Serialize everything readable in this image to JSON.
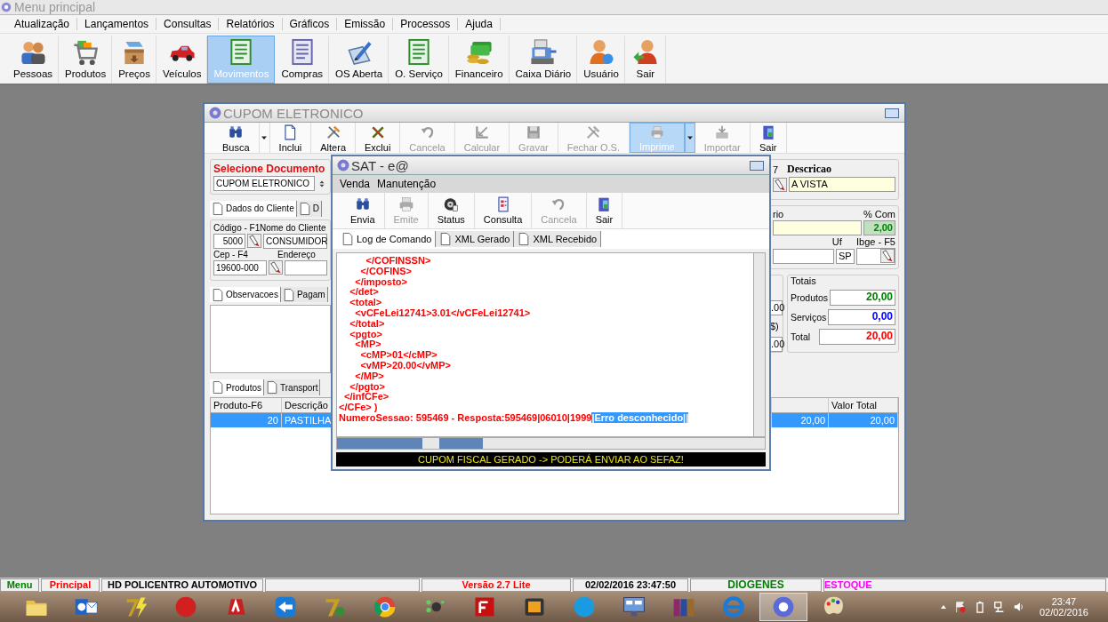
{
  "app": {
    "title": "Menu principal",
    "menu": [
      "Atualização",
      "Lançamentos",
      "Consultas",
      "Relatórios",
      "Gráficos",
      "Emissão",
      "Processos",
      "Ajuda"
    ],
    "toolbar": [
      {
        "label": "Pessoas",
        "selected": false
      },
      {
        "label": "Produtos",
        "selected": false
      },
      {
        "label": "Preços",
        "selected": false
      },
      {
        "label": "Veículos",
        "selected": false
      },
      {
        "label": "Movimentos",
        "selected": true
      },
      {
        "label": "Compras",
        "selected": false
      },
      {
        "label": "OS Aberta",
        "selected": false
      },
      {
        "label": "O. Serviço",
        "selected": false
      },
      {
        "label": "Financeiro",
        "selected": false
      },
      {
        "label": "Caixa Diário",
        "selected": false
      },
      {
        "label": "Usuário",
        "selected": false
      },
      {
        "label": "Sair",
        "selected": false
      }
    ]
  },
  "cupom": {
    "title": "CUPOM ELETRONICO",
    "toolbar": [
      {
        "label": "Busca",
        "disabled": false,
        "selected": false,
        "dropdown": true
      },
      {
        "label": "Inclui",
        "disabled": false,
        "selected": false,
        "dropdown": false
      },
      {
        "label": "Altera",
        "disabled": false,
        "selected": false,
        "dropdown": false
      },
      {
        "label": "Exclui",
        "disabled": false,
        "selected": false,
        "dropdown": false
      },
      {
        "label": "Cancela",
        "disabled": true,
        "selected": false,
        "dropdown": false
      },
      {
        "label": "Calcular",
        "disabled": true,
        "selected": false,
        "dropdown": false
      },
      {
        "label": "Gravar",
        "disabled": true,
        "selected": false,
        "dropdown": false
      },
      {
        "label": "Fechar O.S.",
        "disabled": true,
        "selected": false,
        "dropdown": false
      },
      {
        "label": "Imprime",
        "disabled": true,
        "selected": true,
        "dropdown": true
      },
      {
        "label": "Importar",
        "disabled": true,
        "selected": false,
        "dropdown": false
      },
      {
        "label": "Sair",
        "disabled": false,
        "selected": false,
        "dropdown": false
      }
    ],
    "document": {
      "label": "Selecione Documento",
      "value": "CUPOM ELETRONICO"
    },
    "client_tabs": [
      {
        "label": "Dados do Cliente",
        "selected": true
      },
      {
        "label": "D",
        "selected": false
      }
    ],
    "client": {
      "code_label": "Código - F1",
      "code": "5000",
      "name_label": "Nome do Cliente",
      "name": "CONSUMIDOR",
      "cep_label": "Cep - F4",
      "cep": "19600-000",
      "address_label": "Endereço"
    },
    "notes_tabs": [
      {
        "label": "Observacoes",
        "selected": true
      },
      {
        "label": "Pagam",
        "selected": false
      }
    ],
    "items_tabs": [
      {
        "label": "Produtos",
        "selected": true
      },
      {
        "label": "Transport",
        "selected": false
      }
    ],
    "payment": {
      "code_label": "7",
      "description_label": "Descricao",
      "description": "A VISTA"
    },
    "seller": {
      "label": "rio",
      "commission_label": "% Com",
      "commission": "2,00",
      "uf_label": "Uf",
      "uf": "SP",
      "ibge_label": "Ibge - F5"
    },
    "discounts": {
      "value_1": ".00",
      "label": "$)",
      "value_2": ".00"
    },
    "totals": {
      "title": "Totais",
      "rows": [
        {
          "label": "Produtos",
          "value": "20,00",
          "color": "#008000"
        },
        {
          "label": "Serviços",
          "value": "0,00",
          "color": "#0000ff"
        },
        {
          "label": "Total",
          "value": "20,00",
          "color": "#ff0000"
        }
      ]
    },
    "table": {
      "columns": [
        "Produto-F6",
        "Descrição",
        "",
        "Valor Total"
      ],
      "rows": [
        {
          "cells": [
            "20",
            "PASTILHA",
            "20,00",
            "20,00"
          ],
          "selected": true
        }
      ]
    }
  },
  "sat": {
    "title": "SAT - e@",
    "menu": [
      "Venda",
      "Manutenção"
    ],
    "toolbar": [
      {
        "label": "Envia",
        "disabled": false
      },
      {
        "label": "Emite",
        "disabled": true
      },
      {
        "label": "Status",
        "disabled": false
      },
      {
        "label": "Consulta",
        "disabled": false
      },
      {
        "label": "Cancela",
        "disabled": true
      },
      {
        "label": "Sair",
        "disabled": false
      }
    ],
    "tabs": [
      {
        "label": "Log de Comando",
        "selected": true
      },
      {
        "label": "XML Gerado",
        "selected": false
      },
      {
        "label": "XML Recebido",
        "selected": false
      }
    ],
    "log": [
      {
        "text": "          </COFINSSN>"
      },
      {
        "text": "        </COFINS>"
      },
      {
        "text": "      </imposto>"
      },
      {
        "text": "    </det>"
      },
      {
        "text": "    <total>"
      },
      {
        "text": "      <vCFeLei12741>3.01</vCFeLei12741>"
      },
      {
        "text": "    </total>"
      },
      {
        "text": "    <pgto>"
      },
      {
        "text": "      <MP>"
      },
      {
        "text": "        <cMP>01</cMP>"
      },
      {
        "text": "        <vMP>20.00</vMP>"
      },
      {
        "text": "      </MP>"
      },
      {
        "text": "    </pgto>"
      },
      {
        "text": "  </infCFe>"
      },
      {
        "text": "</CFe> )"
      },
      {
        "text": "NumeroSessao: 595469 - Resposta:595469|06010|1999",
        "selected_text": "|Erro desconhecido||"
      }
    ],
    "status": "CUPOM FISCAL GERADO -> PODERÁ ENVIAR AO SEFAZ!"
  },
  "status_bar": [
    {
      "text": "Menu",
      "color": "#008000"
    },
    {
      "text": "Principal",
      "color": "#ff0000"
    },
    {
      "text": "HD POLICENTRO AUTOMOTIVO",
      "color": "#000000"
    },
    {
      "text": "Versão 2.7 Lite",
      "color": "#ff0000"
    },
    {
      "text": "02/02/2016 23:47:50",
      "color": "#000000"
    },
    {
      "text": "DIOGENES",
      "color": "#008000"
    },
    {
      "text": "ESTOQUE",
      "color": "#ff00ff"
    }
  ],
  "taskbar": {
    "time": "23:47",
    "date": "02/02/2016"
  }
}
